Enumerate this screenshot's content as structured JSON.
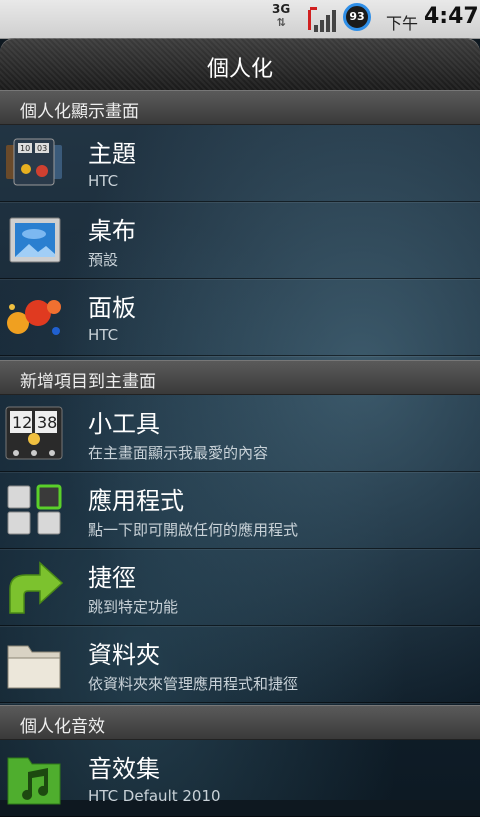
{
  "status": {
    "network": "3G",
    "battery": "93",
    "ampm": "下午",
    "time": "4:47"
  },
  "titlebar": {
    "title": "個人化"
  },
  "sections": [
    {
      "header": "個人化顯示畫面",
      "items": [
        {
          "title": "主題",
          "subtitle": "HTC",
          "icon": "theme-icon"
        },
        {
          "title": "桌布",
          "subtitle": "預設",
          "icon": "wallpaper-icon"
        },
        {
          "title": "面板",
          "subtitle": "HTC",
          "icon": "skin-icon"
        }
      ]
    },
    {
      "header": "新增項目到主畫面",
      "items": [
        {
          "title": "小工具",
          "subtitle": "在主畫面顯示我最愛的內容",
          "icon": "widget-icon"
        },
        {
          "title": "應用程式",
          "subtitle": "點一下即可開啟任何的應用程式",
          "icon": "apps-icon"
        },
        {
          "title": "捷徑",
          "subtitle": "跳到特定功能",
          "icon": "shortcut-arrow-icon"
        },
        {
          "title": "資料夾",
          "subtitle": "依資料夾來管理應用程式和捷徑",
          "icon": "folder-icon"
        }
      ]
    },
    {
      "header": "個人化音效",
      "items": [
        {
          "title": "音效集",
          "subtitle": "HTC Default 2010",
          "icon": "sound-set-icon"
        }
      ]
    }
  ],
  "colors": {
    "battery_ring": "#2f8fe8",
    "shortcut_arrow": "#7cc22e",
    "sound_icon": "#4fae2e"
  }
}
